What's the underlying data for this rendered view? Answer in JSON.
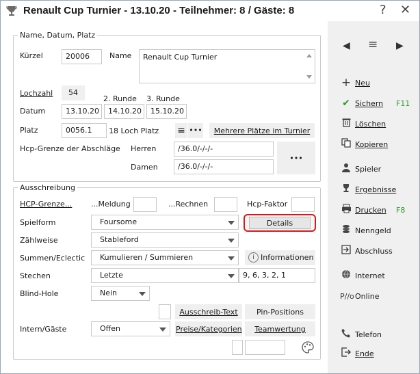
{
  "window": {
    "title": "Renault Cup Turnier - 13.10.20 - Teilnehmer: 8 / Gäste: 8",
    "help": "?",
    "close": "✕"
  },
  "group1": {
    "legend": "Name, Datum, Platz",
    "kuerzel_label": "Kürzel",
    "kuerzel_value": "20006",
    "name_label": "Name",
    "name_value": "Renault Cup Turnier",
    "lochzahl_label": "Lochzahl",
    "lochzahl_value": "54",
    "runde2_label": "2. Runde",
    "runde3_label": "3. Runde",
    "datum_label": "Datum",
    "datum1": "13.10.20",
    "datum2": "14.10.20",
    "datum3": "15.10.20",
    "platz_label": "Platz",
    "platz_value": "0056.1",
    "platz_desc": "18 Loch Platz",
    "mehrere_plaetze": "Mehrere Plätze im Turnier",
    "hcp_grenze_label": "Hcp-Grenze der Abschläge",
    "herren_label": "Herren",
    "herren_value": "/36.0/-/-/-",
    "damen_label": "Damen",
    "damen_value": "/36.0/-/-/-",
    "more_dots": "•••"
  },
  "group2": {
    "legend": "Ausschreibung",
    "hcp_grenze_label": "HCP-Grenze...",
    "meldung_label": "...Meldung",
    "rechnen_label": "...Rechnen",
    "hcp_faktor_label": "Hcp-Faktor",
    "spielform_label": "Spielform",
    "spielform_value": "Foursome",
    "details_button": "Details",
    "zaehlweise_label": "Zählweise",
    "zaehlweise_value": "Stableford",
    "summen_label": "Summen/Eclectic",
    "summen_value": "Kumulieren / Summieren",
    "informationen_button": "Informationen",
    "stechen_label": "Stechen",
    "stechen_value": "Letzte",
    "stechen_holes": "9, 6, 3, 2, 1",
    "blindhole_label": "Blind-Hole",
    "blindhole_value": "Nein",
    "ausschreib_text": "Ausschreib-Text",
    "pin_positions": "Pin-Positions",
    "intern_label": "Intern/Gäste",
    "intern_value": "Offen",
    "preise_kategorien": "Preise/Kategorien",
    "teamwertung": "Teamwertung"
  },
  "sidebar": {
    "nav": {
      "prev": "◀",
      "list": "≡",
      "next": "▶"
    },
    "items": [
      {
        "label": "Neu",
        "icon": "plus-icon"
      },
      {
        "label": "Sichern",
        "icon": "checkmark-icon",
        "key": "F11"
      },
      {
        "label": "Löschen",
        "icon": "trash-icon"
      },
      {
        "label": "Kopieren",
        "icon": "copy-icon"
      },
      {
        "label": "Spieler",
        "icon": "person-icon"
      },
      {
        "label": "Ergebnisse",
        "icon": "trophy-icon"
      },
      {
        "label": "Drucken",
        "icon": "printer-icon",
        "key": "F8"
      },
      {
        "label": "Nenngeld",
        "icon": "coins-icon"
      },
      {
        "label": "Abschluss",
        "icon": "exit-arrow-icon"
      },
      {
        "label": "Internet",
        "icon": "globe-icon"
      },
      {
        "label": "Online",
        "icon": "online-icon"
      },
      {
        "label": "Telefon",
        "icon": "phone-icon"
      },
      {
        "label": "Ende",
        "icon": "exit-icon"
      }
    ]
  },
  "colors": {
    "highlight_red": "#d61a1a",
    "hotkey_green": "#2e9b2e",
    "sidebar_bg": "#f0f0f0"
  }
}
